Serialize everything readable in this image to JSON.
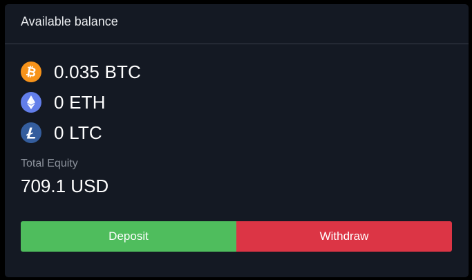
{
  "card": {
    "title": "Available balance"
  },
  "balances": [
    {
      "icon": "bitcoin-icon",
      "color": "#f7931a",
      "text": "0.035 BTC"
    },
    {
      "icon": "ethereum-icon",
      "color": "#627eea",
      "text": "0 ETH"
    },
    {
      "icon": "litecoin-icon",
      "color": "#345d9d",
      "text": "0 LTC"
    }
  ],
  "equity": {
    "label": "Total Equity",
    "value": "709.1 USD"
  },
  "actions": {
    "deposit_label": "Deposit",
    "deposit_color": "#4fbd5d",
    "withdraw_label": "Withdraw",
    "withdraw_color": "#dc3545"
  }
}
